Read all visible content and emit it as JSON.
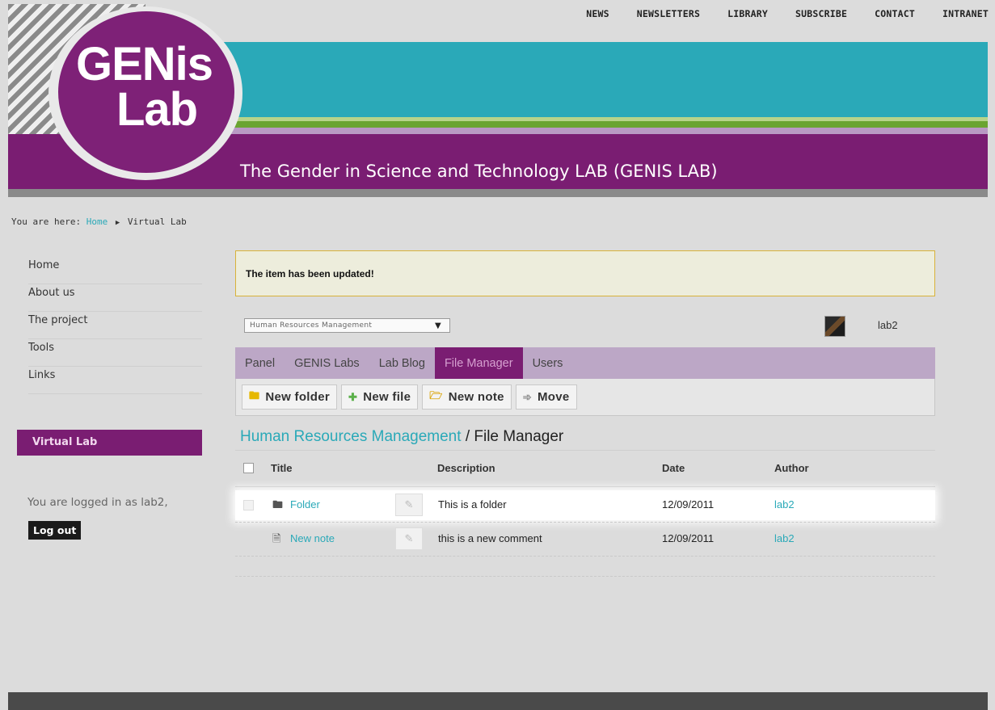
{
  "top_nav": [
    "NEWS",
    "NEWSLETTERS",
    "LIBRARY",
    "SUBSCRIBE",
    "CONTACT",
    "INTRANET"
  ],
  "logo": {
    "line1": "GENis",
    "line2": "Lab"
  },
  "site_title": "The Gender in Science and Technology LAB (GENIS LAB)",
  "breadcrumb": {
    "prefix": "You are here:",
    "home": "Home",
    "sep": "▶",
    "current": "Virtual Lab"
  },
  "sidebar": {
    "items": [
      "Home",
      "About us",
      "The project",
      "Tools",
      "Links"
    ],
    "section": "Virtual Lab",
    "logged_in": "You are logged in as lab2,",
    "logout": "Log out"
  },
  "alert": "The item has been updated!",
  "lab_select": {
    "value": "Human Resources Management",
    "arrow": "▼"
  },
  "user": {
    "name": "lab2"
  },
  "tabs": [
    {
      "label": "Panel",
      "active": false
    },
    {
      "label": "GENIS Labs",
      "active": false
    },
    {
      "label": "Lab Blog",
      "active": false
    },
    {
      "label": "File Manager",
      "active": true
    },
    {
      "label": "Users",
      "active": false
    }
  ],
  "toolbar": {
    "new_folder": "New folder",
    "new_file": "New file",
    "new_note": "New note",
    "move": "Move"
  },
  "section": {
    "link": "Human Resources Management",
    "suffix": "/ File Manager"
  },
  "table": {
    "headers": {
      "title": "Title",
      "description": "Description",
      "date": "Date",
      "author": "Author"
    },
    "rows": [
      {
        "icon": "folder-icon",
        "title": "Folder",
        "description": "This is a folder",
        "date": "12/09/2011",
        "author": "lab2"
      },
      {
        "icon": "note-icon",
        "title": "New note",
        "description": "this is a new comment",
        "date": "12/09/2011",
        "author": "lab2"
      }
    ]
  },
  "colors": {
    "teal": "#2aa9b8",
    "purple": "#7a1d72",
    "lilac": "#bca7c6",
    "green": "#6aa431"
  }
}
